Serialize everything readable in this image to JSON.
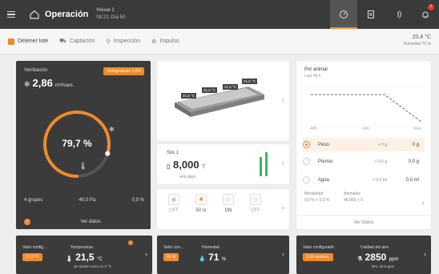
{
  "header": {
    "title": "Operación",
    "house_name": "House 1",
    "house_time": "08:22, Día 50",
    "notification_count": "7"
  },
  "subbar": {
    "items": [
      "Detener lote",
      "Captación",
      "Inspección",
      "Impulso"
    ],
    "weather_temp": "20,4 °C",
    "weather_humidity": "Humedad 76 %"
  },
  "ventilation": {
    "title": "Ventilación",
    "badge": "Refrigeración 1,0%",
    "value": "2,86",
    "unit": "m³/h/ani.",
    "gauge_value": "79,7 %",
    "gauge_fraction": 0.797,
    "stats": [
      "4 grupos",
      "40,0 Pa",
      "0,9 %"
    ],
    "footer_info": "i",
    "footer_link": "Ver datos"
  },
  "silo": {
    "labels": [
      "21,5 °C",
      "21,5 °C",
      "21,5 °C",
      "21,5 °C"
    ],
    "title": "Silo 1",
    "value": "8,000",
    "unit": "T",
    "sub": "rem.days",
    "mini": [
      {
        "state": "OFF",
        "icon": "▣"
      },
      {
        "state": "50 lx",
        "icon": "✺"
      },
      {
        "state": "ON",
        "icon": "◇"
      },
      {
        "state": "OFF",
        "icon": "◷"
      }
    ]
  },
  "weight": {
    "title": "Por animal",
    "subtitle": "Last 48 h",
    "axis": [
      "-48h",
      "-24h",
      "Now"
    ],
    "options": [
      {
        "name": "Peso",
        "v1": "+ 0 g",
        "v2": "0 g"
      },
      {
        "name": "Pienso",
        "v1": "+ 0,0 g",
        "v2": "0,0 g"
      },
      {
        "name": "Agua",
        "v1": "+ 0,0 ml",
        "v2": "0,0 ml"
      }
    ],
    "mortality_label": "Mortalidad",
    "mortality_values": "0,0 %  + 0,0 %",
    "animals_label": "Animales",
    "animals_values": "45.000 + 0",
    "footer_link": "Ver datos"
  },
  "temperature": {
    "config_label": "Valor config...",
    "config_pill": "21,5 °C",
    "label": "Temperatura",
    "value": "21,5",
    "unit": "°C",
    "sub": "Se siente como 21,3 °C"
  },
  "humidity": {
    "config_label": "Valor con...",
    "config_pill": "65 %",
    "label": "Humedad",
    "value": "71",
    "unit": "%"
  },
  "air": {
    "config_label": "Valor configurado",
    "config_pill": "1,06 mm/sec.",
    "label": "Calidad del aire",
    "value": "2850",
    "unit": "ppm",
    "sub": "NH₃ 32,0 ppm"
  },
  "colors": {
    "accent": "#f08a2a",
    "dark_card": "#3b3b3b",
    "green": "#3db85c"
  }
}
